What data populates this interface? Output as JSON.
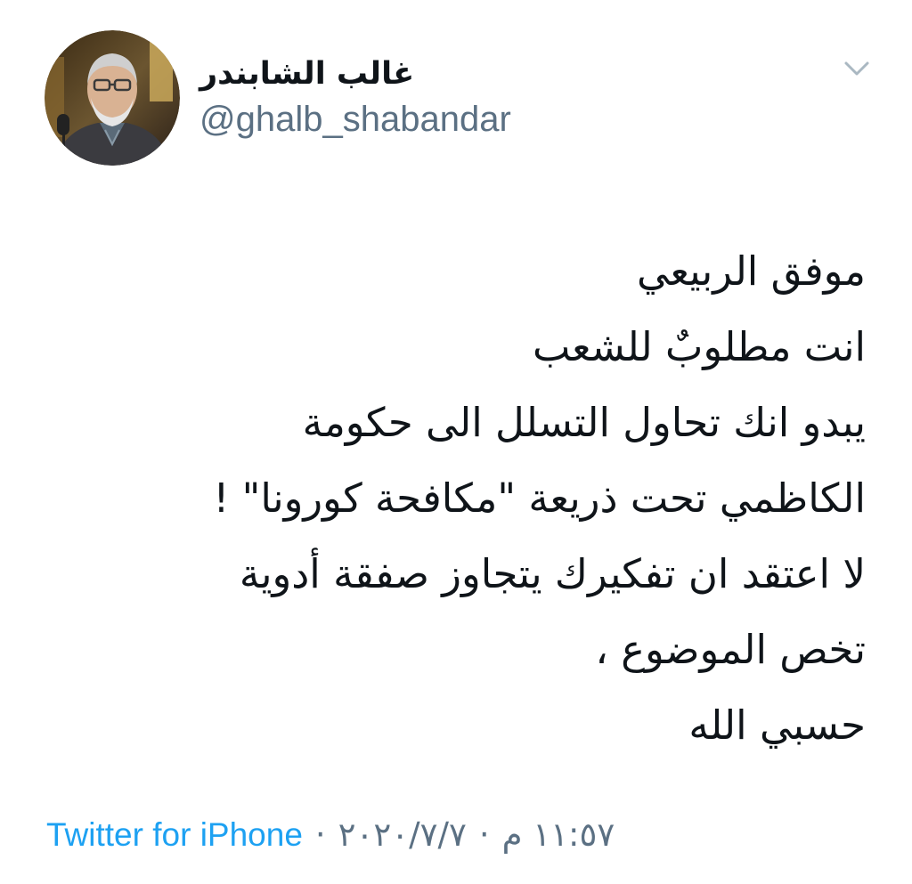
{
  "author": {
    "display_name": "غالب الشابندر",
    "handle": "@ghalb_shabandar",
    "avatar_icon": "avatar-photo"
  },
  "menu": {
    "icon": "chevron-down-icon",
    "color": "#aab8c2"
  },
  "tweet": {
    "lines": [
      "موفق الربيعي",
      "انت مطلوبٌ للشعب",
      "يبدو انك تحاول التسلل الى حكومة",
      "الكاظمي تحت ذريعة \"مكافحة كورونا\" !",
      "لا اعتقد ان تفكيرك يتجاوز صفقة أدوية",
      "تخص الموضوع ،",
      "حسبي الله"
    ]
  },
  "meta": {
    "source": "Twitter for iPhone",
    "separator": "·",
    "date": "٢٠٢٠/٧/٧",
    "time": "١١:٥٧ م"
  },
  "colors": {
    "link": "#1da1f2",
    "secondary": "#5b7083",
    "text": "#0f1419"
  }
}
